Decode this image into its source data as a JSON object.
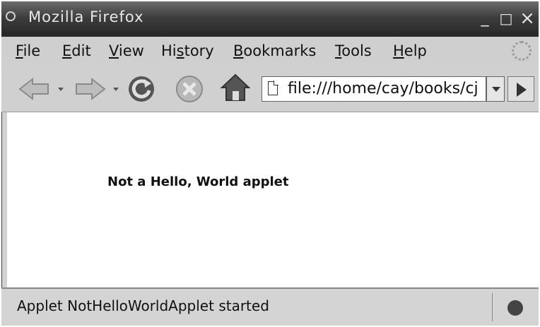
{
  "window": {
    "title": "Mozilla Firefox",
    "controls": {
      "minimize": "_",
      "maximize": "□",
      "close": "×"
    }
  },
  "menu": {
    "items": [
      {
        "pre": "",
        "u": "F",
        "post": "ile"
      },
      {
        "pre": "",
        "u": "E",
        "post": "dit"
      },
      {
        "pre": "",
        "u": "V",
        "post": "iew"
      },
      {
        "pre": "Hi",
        "u": "s",
        "post": "tory"
      },
      {
        "pre": "",
        "u": "B",
        "post": "ookmarks"
      },
      {
        "pre": "",
        "u": "T",
        "post": "ools"
      },
      {
        "pre": "",
        "u": "H",
        "post": "elp"
      }
    ]
  },
  "toolbar": {
    "icons": [
      "back-arrow-icon",
      "forward-arrow-icon",
      "reload-icon",
      "stop-icon",
      "home-icon"
    ],
    "url": "file:///home/cay/books/cj"
  },
  "content": {
    "applet_text": "Not a Hello, World applet"
  },
  "status": {
    "text": "Applet NotHelloWorldApplet started"
  }
}
